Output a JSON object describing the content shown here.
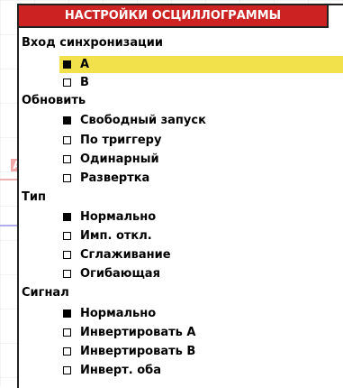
{
  "title": "НАСТРОЙКИ ОСЦИЛЛОГРАММЫ",
  "channel_marker": "A",
  "colors": {
    "title_bar": "#cc2222",
    "highlight": "#f2e14a",
    "trace_a": "#e9a2a2",
    "trace_b": "#a9a6e8"
  },
  "sections": {
    "sync_input": {
      "label": "Вход синхронизации",
      "options": [
        {
          "label": "A",
          "checked": true,
          "highlighted": true
        },
        {
          "label": "B",
          "checked": false
        }
      ]
    },
    "update": {
      "label": "Обновить",
      "options": [
        {
          "label": "Свободный запуск",
          "checked": true
        },
        {
          "label": "По триггеру",
          "checked": false
        },
        {
          "label": "Одинарный",
          "checked": false
        },
        {
          "label": "Развертка",
          "checked": false
        }
      ]
    },
    "type": {
      "label": "Тип",
      "options": [
        {
          "label": "Нормально",
          "checked": true
        },
        {
          "label": "Имп. откл.",
          "checked": false
        },
        {
          "label": "Сглаживание",
          "checked": false
        },
        {
          "label": "Огибающая",
          "checked": false
        }
      ]
    },
    "signal": {
      "label": "Сигнал",
      "options": [
        {
          "label": "Нормально",
          "checked": true
        },
        {
          "label": "Инвертировать A",
          "checked": false
        },
        {
          "label": "Инвертировать B",
          "checked": false
        },
        {
          "label": "Инверт. оба",
          "checked": false
        }
      ]
    }
  }
}
